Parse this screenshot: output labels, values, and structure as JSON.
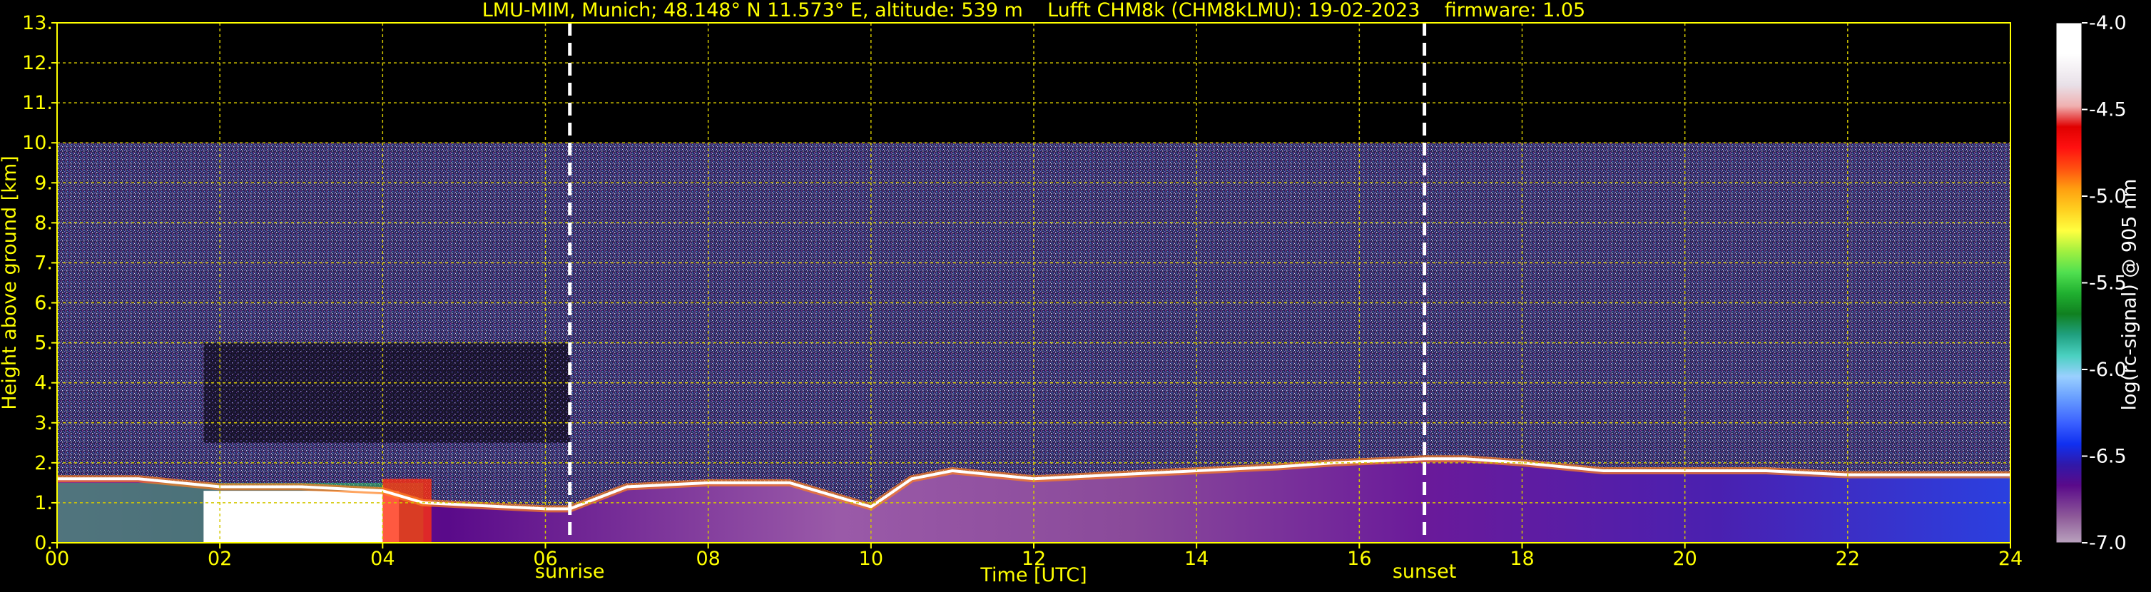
{
  "chart_data": {
    "type": "heatmap",
    "title": "LMU-MIM, Munich; 48.148° N 11.573° E, altitude: 539 m    Lufft CHM8k (CHM8kLMU): 19-02-2023    firmware: 1.05",
    "xlabel": "Time [UTC]",
    "ylabel": "Height above ground [km]",
    "xlim": [
      0,
      24
    ],
    "ylim": [
      0,
      13
    ],
    "x_ticks": [
      "00",
      "02",
      "04",
      "06",
      "08",
      "10",
      "12",
      "14",
      "16",
      "18",
      "20",
      "22",
      "24"
    ],
    "y_ticks": [
      "0.",
      "1.",
      "2.",
      "3.",
      "4.",
      "5.",
      "6.",
      "7.",
      "8.",
      "9.",
      "10.",
      "11.",
      "12.",
      "13."
    ],
    "grid": true,
    "markers": [
      {
        "label": "sunrise",
        "x": 6.3
      },
      {
        "label": "sunset",
        "x": 16.8
      }
    ],
    "colorbar": {
      "label": "log(rc-signal) @ 905 nm",
      "range": [
        -7.0,
        -4.0
      ],
      "ticks": [
        "-4.0",
        "-4.5",
        "-5.0",
        "-5.5",
        "-6.0",
        "-6.5",
        "-7.0"
      ]
    },
    "signal_top_km": 10,
    "boundary_layer_height_km": [
      [
        0,
        1.6
      ],
      [
        1,
        1.6
      ],
      [
        2,
        1.4
      ],
      [
        3,
        1.4
      ],
      [
        4,
        1.3
      ],
      [
        4.5,
        1.0
      ],
      [
        5,
        0.95
      ],
      [
        6,
        0.85
      ],
      [
        6.3,
        0.85
      ],
      [
        7,
        1.4
      ],
      [
        8,
        1.5
      ],
      [
        9,
        1.5
      ],
      [
        10,
        0.9
      ],
      [
        10.5,
        1.6
      ],
      [
        11,
        1.8
      ],
      [
        12,
        1.6
      ],
      [
        13,
        1.7
      ],
      [
        14,
        1.8
      ],
      [
        15,
        1.9
      ],
      [
        15.7,
        2.0
      ],
      [
        16.8,
        2.1
      ],
      [
        17.3,
        2.1
      ],
      [
        18,
        2.0
      ],
      [
        19,
        1.8
      ],
      [
        20,
        1.8
      ],
      [
        21,
        1.8
      ],
      [
        22,
        1.7
      ],
      [
        23,
        1.7
      ],
      [
        24,
        1.7
      ]
    ]
  },
  "colors": {
    "text": "#ffff00",
    "grid": "#d4c800",
    "background": "#000000",
    "marker": "#ffffff"
  }
}
